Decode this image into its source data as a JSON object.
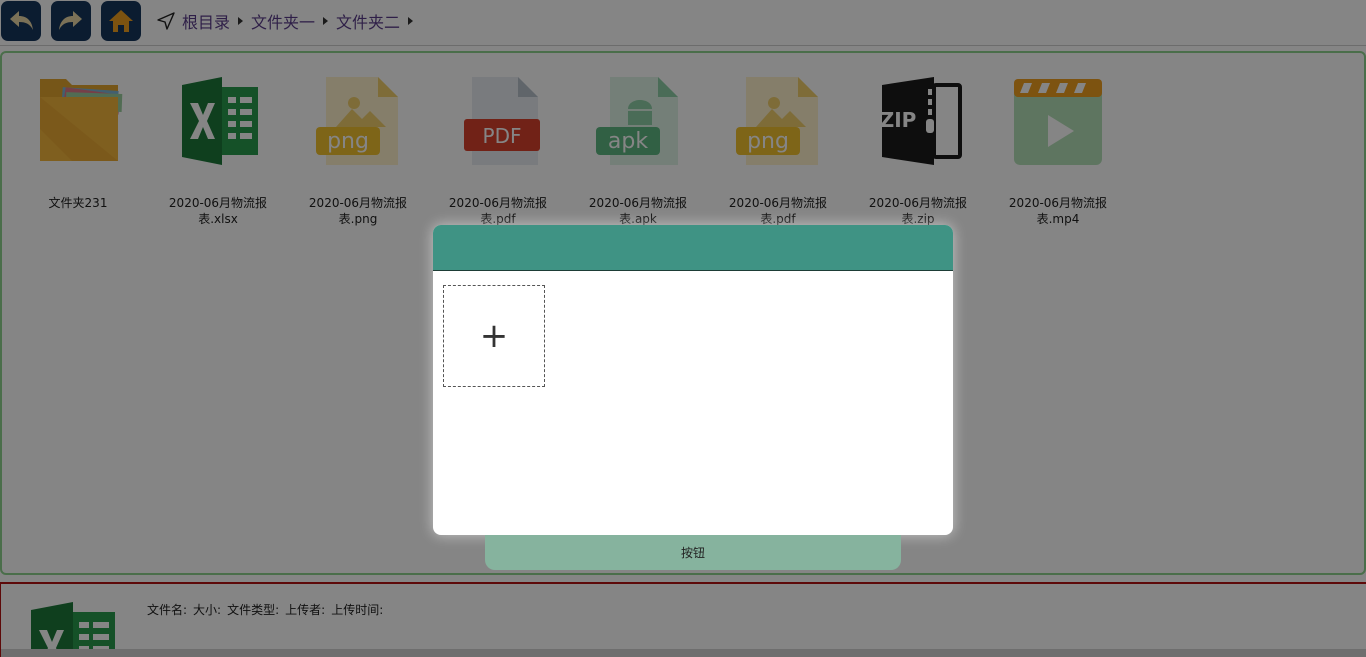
{
  "toolbar": {
    "back_icon": "undo-arrow-icon",
    "forward_icon": "redo-arrow-icon",
    "home_icon": "home-icon",
    "location_icon": "location-arrow-icon",
    "breadcrumbs": [
      "根目录",
      "文件夹一",
      "文件夹二"
    ]
  },
  "files": [
    {
      "name": "文件夹231",
      "type": "folder",
      "icon": "folder-icon"
    },
    {
      "name": "2020-06月物流报表.xlsx",
      "type": "xlsx",
      "icon": "excel-file-icon"
    },
    {
      "name": "2020-06月物流报表.png",
      "type": "png",
      "icon": "image-file-icon",
      "badge": "png"
    },
    {
      "name": "2020-06月物流报表.pdf",
      "type": "pdf",
      "icon": "pdf-file-icon",
      "badge": "PDF"
    },
    {
      "name": "2020-06月物流报表.apk",
      "type": "apk",
      "icon": "apk-file-icon",
      "badge": "apk"
    },
    {
      "name": "2020-06月物流报表.pdf",
      "type": "png",
      "icon": "image-file-icon",
      "badge": "png"
    },
    {
      "name": "2020-06月物流报表.zip",
      "type": "zip",
      "icon": "zip-file-icon",
      "badge": "ZIP"
    },
    {
      "name": "2020-06月物流报表.mp4",
      "type": "mp4",
      "icon": "video-file-icon"
    }
  ],
  "details": {
    "icon": "excel-file-icon",
    "labels": [
      "文件名:",
      "大小:",
      "文件类型:",
      "上传者:",
      "上传时间:"
    ]
  },
  "modal": {
    "title": "",
    "upload_symbol": "+",
    "button_label": "按钮"
  },
  "colors": {
    "nav_button": "#16365c",
    "home_icon": "#f0a020",
    "modal_header": "#3f9384",
    "modal_button": "#86b39e",
    "grid_border": "#8fd48f",
    "detail_border": "#b31212"
  }
}
